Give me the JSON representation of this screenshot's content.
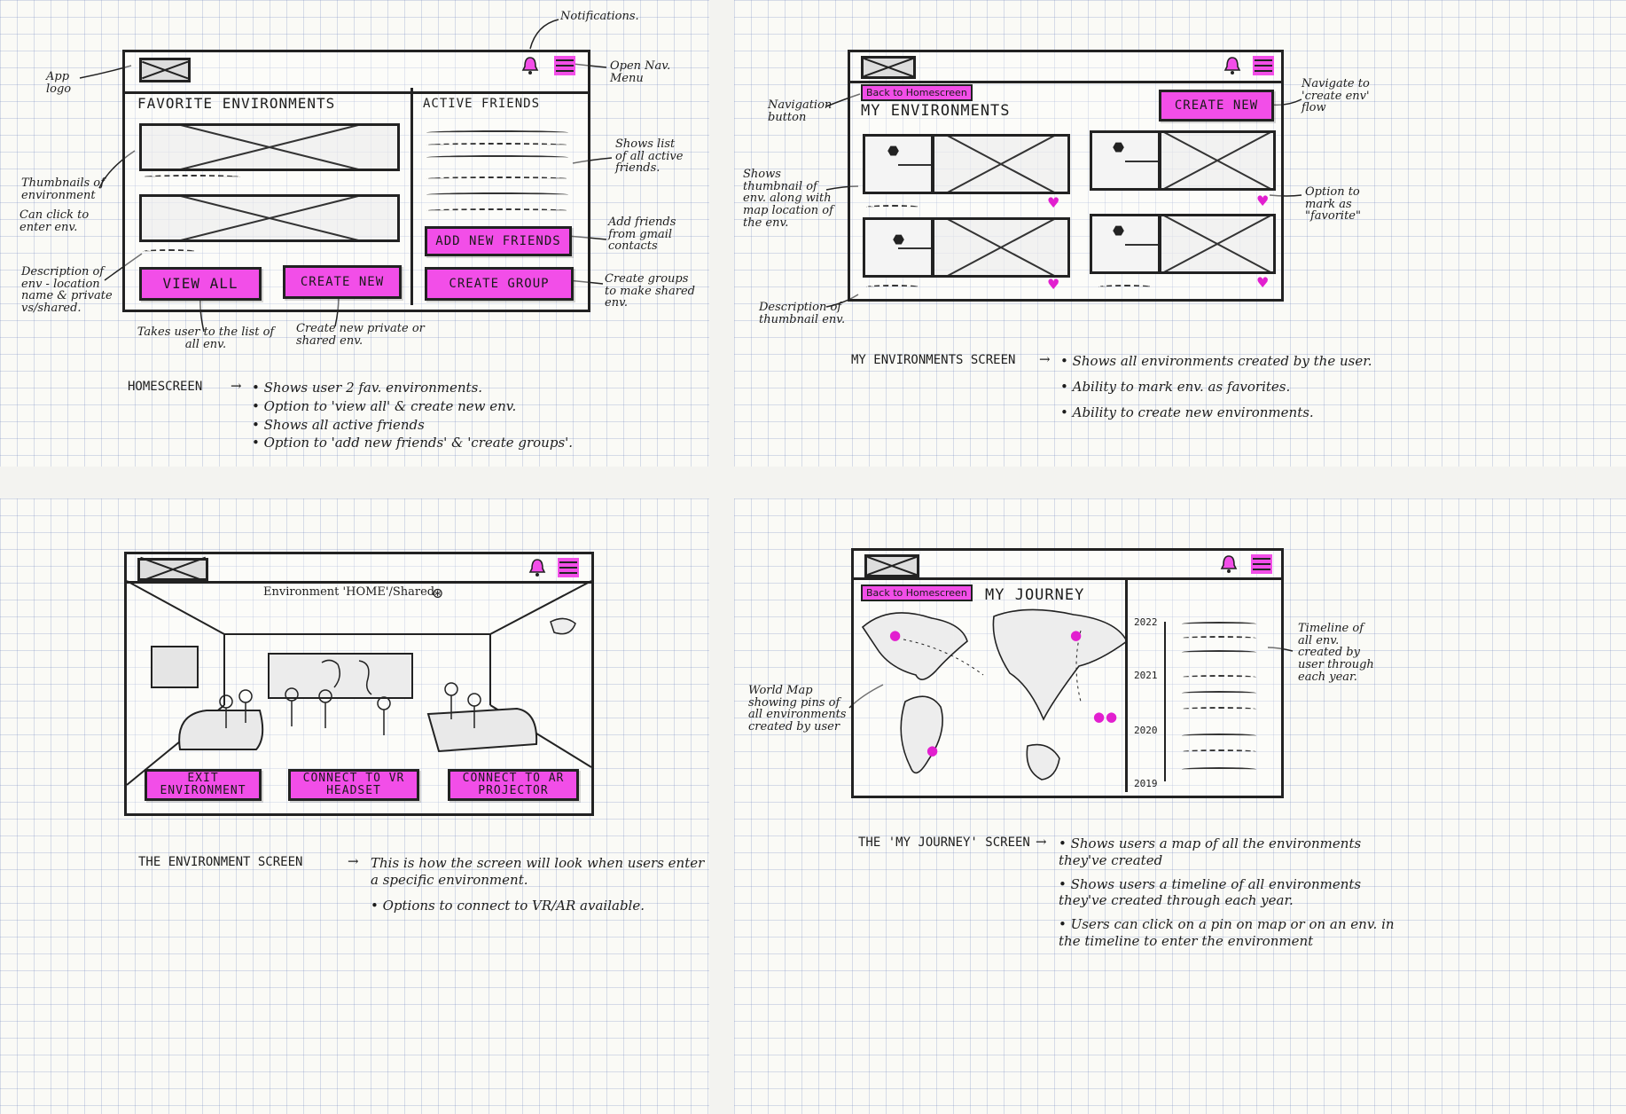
{
  "colors": {
    "accent": "#f24ee8",
    "ink": "#222222",
    "grid": "#9aa9cc"
  },
  "home": {
    "section_favorites": "FAVORITE ENVIRONMENTS",
    "section_friends": "ACTIVE FRIENDS",
    "btn_view_all": "VIEW ALL",
    "btn_create_new": "CREATE NEW",
    "btn_add_friends": "ADD NEW FRIENDS",
    "btn_create_group": "CREATE GROUP",
    "notes": {
      "notifications": "Notifications.",
      "app_logo": "App logo",
      "open_nav": "Open Nav. Menu",
      "thumbnails": "Thumbnails of environment",
      "click_enter": "Can click to enter env.",
      "description": "Description of env - location name & private vs/shared.",
      "friends_list": "Shows list of all active friends.",
      "add_friends": "Add friends from gmail contacts",
      "create_groups": "Create groups to make shared env.",
      "view_all": "Takes user to the list of all env.",
      "create_new": "Create new private or shared env."
    },
    "caption_label": "HOMESCREEN",
    "caption_points": [
      "Shows user 2 fav. environments.",
      "Option to 'view all' & create new env.",
      "Shows all active friends",
      "Option to 'add new friends' & 'create groups'."
    ]
  },
  "myenv": {
    "back_tag": "Back to Homescreen",
    "title": "MY ENVIRONMENTS",
    "btn_create_new": "CREATE NEW",
    "notes": {
      "nav_button": "Navigation button",
      "thumbnail_map": "Shows thumbnail of env. along with map location of the env.",
      "create_flow": "Navigate to 'create env' flow",
      "favorite": "Option to mark as \"favorite\"",
      "description": "Description of thumbnail env."
    },
    "caption_label": "MY ENVIRONMENTS SCREEN",
    "caption_points": [
      "Shows all environments created by the user.",
      "Ability to mark env. as favorites.",
      "Ability to create new environments."
    ]
  },
  "envscreen": {
    "breadcrumb": "Environment 'HOME'/Shared",
    "btn_exit": "EXIT ENVIRONMENT",
    "btn_vr": "CONNECT TO VR HEADSET",
    "btn_ar": "CONNECT TO AR PROJECTOR",
    "caption_label": "THE ENVIRONMENT SCREEN",
    "caption_points": [
      "This is how the screen will look when users enter a specific environment.",
      "Options to connect to VR/AR available."
    ]
  },
  "journey": {
    "back_tag": "Back to Homescreen",
    "title": "MY JOURNEY",
    "years": [
      "2022",
      "2021",
      "2020",
      "2019"
    ],
    "notes": {
      "timeline": "Timeline of all env. created by user through each year.",
      "world_map": "World Map showing pins of all environments created by user"
    },
    "caption_label": "THE 'MY JOURNEY' SCREEN",
    "caption_points": [
      "Shows users a map of all the environments they've created",
      "Shows users a timeline of all environments they've created through each year.",
      "Users can click on a pin on map or on an env. in the timeline to enter the environment"
    ]
  }
}
